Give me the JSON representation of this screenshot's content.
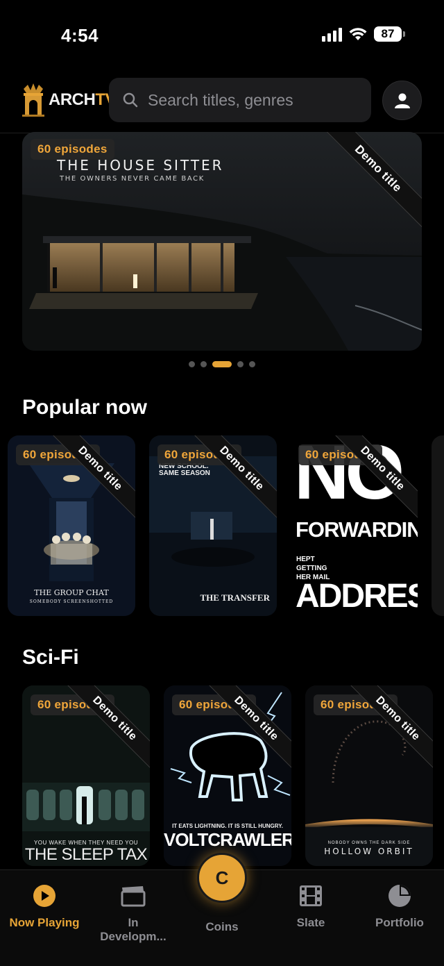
{
  "status_bar": {
    "time": "4:54",
    "battery": "87"
  },
  "header": {
    "logo_arch": "ARCH",
    "logo_tv": "TV",
    "search_placeholder": "Search titles, genres"
  },
  "hero": {
    "badge": "60 episodes",
    "ribbon": "Demo title",
    "poster_title": "THE HOUSE SITTER",
    "poster_tagline": "THE OWNERS NEVER CAME BACK",
    "carousel_active_index": 2,
    "carousel_count": 5
  },
  "popular": {
    "title": "Popular now",
    "cards": [
      {
        "badge": "60 episodes",
        "ribbon": "Demo title",
        "poster_title": "THE GROUP CHAT",
        "poster_tagline": "SOMEBODY SCREENSHOTTED"
      },
      {
        "badge": "60 episodes",
        "ribbon": "Demo title",
        "poster_top": "NEW SCHOOL. SAME SEASON",
        "poster_title": "THE TRANSFER"
      },
      {
        "badge": "60 episodes",
        "ribbon": "Demo title",
        "poster_big": "NO",
        "poster_mid": "FORWARDING",
        "poster_small": "HEPT GETTING HER MAIL",
        "poster_bottom": "ADDRESS",
        "poster_corner": "KEPT GETTING"
      }
    ]
  },
  "scifi": {
    "title": "Sci-Fi",
    "cards": [
      {
        "badge": "60 episodes",
        "ribbon": "Demo title",
        "poster_tagline": "YOU WAKE WHEN THEY NEED YOU",
        "poster_title": "THE SLEEP TAX"
      },
      {
        "badge": "60 episodes",
        "ribbon": "Demo title",
        "poster_tagline": "IT EATS LIGHTNING. IT IS STILL HUNGRY.",
        "poster_title": "VOLTCRAWLER"
      },
      {
        "badge": "60 episodes",
        "ribbon": "Demo title",
        "poster_tagline": "NOBODY OWNS THE DARK SIDE",
        "poster_title": "HOLLOW ORBIT"
      }
    ]
  },
  "nav": {
    "now_playing": "Now Playing",
    "in_development_1": "In",
    "in_development_2": "Developm...",
    "coins_symbol": "C",
    "coins": "Coins",
    "slate": "Slate",
    "portfolio": "Portfolio"
  },
  "colors": {
    "accent": "#e6a436",
    "background": "#000000",
    "muted": "#8e8e93"
  }
}
